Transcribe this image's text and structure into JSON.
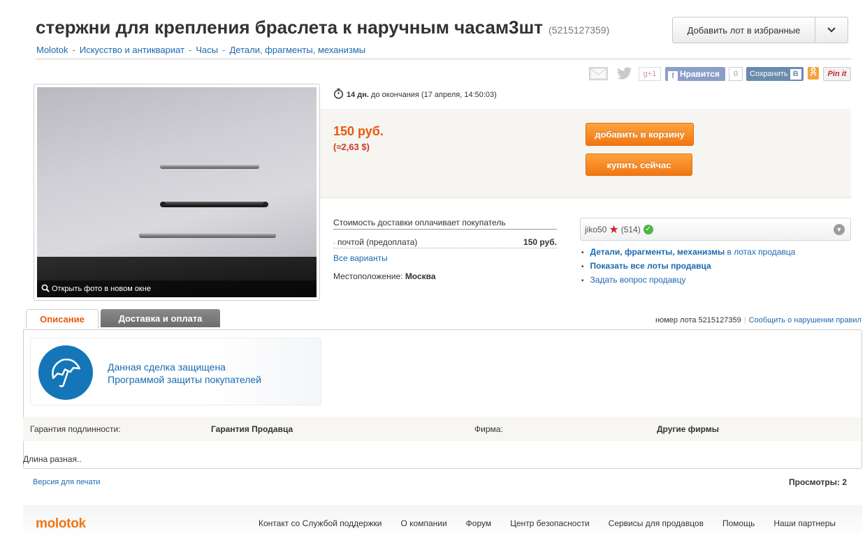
{
  "header": {
    "title": "стержни для крепления браслета к наручным часам3шт",
    "lot_id": "(5215127359)",
    "favorite_button": "Добавить лот в избранные"
  },
  "breadcrumb": [
    "Molotok",
    "Искусство и антиквариат",
    "Часы",
    "Детали, фрагменты, механизмы"
  ],
  "breadcrumb_sep": "-",
  "social": {
    "gplus": "g+1",
    "fb_like": "Нравится",
    "fb_count": "0",
    "vk_save": "Сохранить",
    "vk_b": "В",
    "pinit": "Pin it"
  },
  "photo": {
    "open_link": "Открыть фото в новом окне"
  },
  "timer": {
    "days": "14 дн.",
    "rest": "до окончания (17 апреля, 14:50:03)"
  },
  "price": {
    "rub": "150 руб.",
    "usd": "(≈2,63 $)"
  },
  "buttons": {
    "cart": "добавить в корзину",
    "buy": "купить сейчас"
  },
  "delivery": {
    "title": "Стоимость доставки оплачивает покупатель",
    "method": "почтой (предоплата)",
    "method_price": "150 руб.",
    "all_variants": "Все варианты",
    "location_label": "Местоположение:",
    "location_value": "Москва"
  },
  "seller": {
    "name": "jiko50",
    "rating": "(514)",
    "link1_bold": "Детали, фрагменты, механизмы",
    "link1_rest": " в лотах продавца",
    "link2": "Показать все лоты продавца",
    "link3": "Задать вопрос продавцу"
  },
  "tabs": {
    "description": "Описание",
    "delivery": "Доставка и оплата"
  },
  "lot_number": {
    "label": "номер лота 5215127359",
    "report": "Сообщить о нарушении правил"
  },
  "protection": {
    "line1": "Данная сделка защищена",
    "line2": "Программой защиты покупателей"
  },
  "attributes": {
    "authenticity_label": "Гарантия подлинности:",
    "authenticity_value": "Гарантия Продавца",
    "brand_label": "Фирма:",
    "brand_value": "Другие фирмы"
  },
  "description_text": "Длина разная..",
  "print_version": "Версия для печати",
  "views": "Просмотры: 2",
  "footer": {
    "logo": "molotok",
    "links": [
      "Контакт со Службой поддержки",
      "О компании",
      "Форум",
      "Центр безопасности",
      "Сервисы для продавцов",
      "Помощь",
      "Наши партнеры"
    ]
  },
  "colors": {
    "accent_orange": "#f07612",
    "link_blue": "#1a6ab0",
    "price_orange": "#e8590c"
  }
}
